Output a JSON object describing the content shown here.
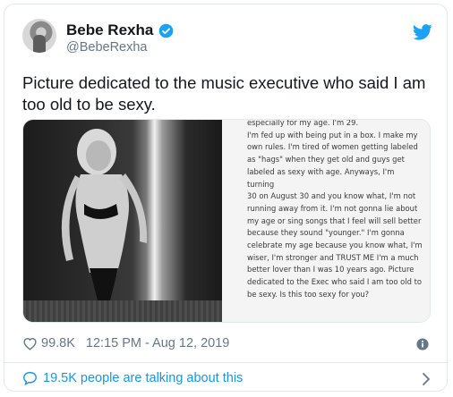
{
  "author": {
    "name": "Bebe Rexha",
    "handle": "@BebeRexha"
  },
  "tweet": {
    "text": "Picture dedicated to the music executive who said I am too old to be sexy."
  },
  "media": {
    "notes_lines": [
      "especially for my age. I'm 29.",
      "I'm fed up with being put in a box. I make my",
      "own rules. I'm tired of women getting labeled",
      "as \"hags\" when they get old and guys get",
      "labeled as sexy with age. Anyways, I'm turning",
      "30 on August 30 and you know what, I'm not",
      "running away from it. I'm not gonna lie about",
      "my age or sing songs that I feel will sell better",
      "because they sound \"younger.\" I'm gonna",
      "celebrate my age because you know what, I'm",
      "wiser, I'm stronger and TRUST ME I'm a much",
      "better lover than I was 10 years ago. Picture",
      "dedicated to the Exec who said I am too old to",
      "be sexy. Is this too sexy for you?"
    ]
  },
  "meta": {
    "likes": "99.8K",
    "timestamp": "12:15 PM - Aug 12, 2019"
  },
  "footer": {
    "talking": "19.5K people are talking about this"
  },
  "colors": {
    "twitter_blue": "#1DA1F2",
    "link_blue": "#1B95E0",
    "muted": "#657786"
  }
}
